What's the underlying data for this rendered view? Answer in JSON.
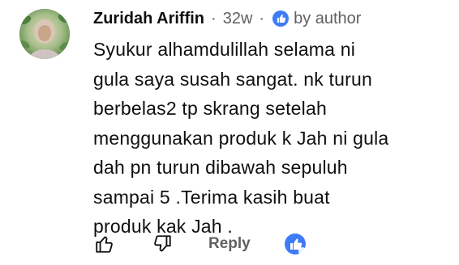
{
  "comment": {
    "author_name": "Zuridah Ariffin",
    "timestamp": "32w",
    "separator": "·",
    "badge_text": "by author",
    "text": "Syukur alhamdulillah selama ni\ngula saya susah sangat. nk turun\nberbelas2 tp skrang setelah\nmenggunakan produk k Jah ni gula\ndah pn turun dibawah sepuluh\nsampai 5 .Terima kasih buat\nproduk kak Jah .",
    "avatar_icon": "user-avatar-photo"
  },
  "actions": {
    "like_icon": "thumbs-up-outline-icon",
    "dislike_icon": "thumbs-down-outline-icon",
    "reply_label": "Reply",
    "creator_heart_icon": "thumbs-up-creator-badge-icon"
  },
  "colors": {
    "text_primary": "#0f0f0f",
    "text_secondary": "#606060",
    "accent_blue": "#3e7bf7"
  }
}
